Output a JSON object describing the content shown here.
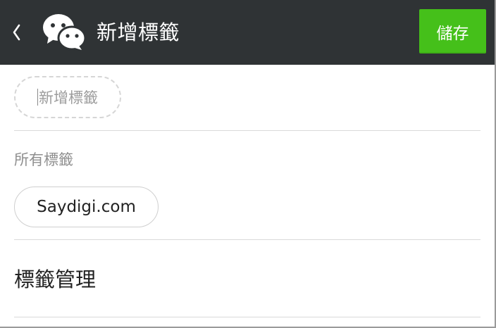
{
  "header": {
    "title": "新增標籤",
    "save_label": "儲存",
    "back_icon": "chevron-left-icon",
    "logo_icon": "wechat-logo-icon",
    "background_color": "#2f3335",
    "save_color": "#45c01a"
  },
  "new_tag": {
    "placeholder": "新增標籤",
    "value": ""
  },
  "all_tags": {
    "label": "所有標籤",
    "tags": [
      {
        "label": "Saydigi.com"
      }
    ]
  },
  "manage": {
    "label": "標籤管理"
  }
}
